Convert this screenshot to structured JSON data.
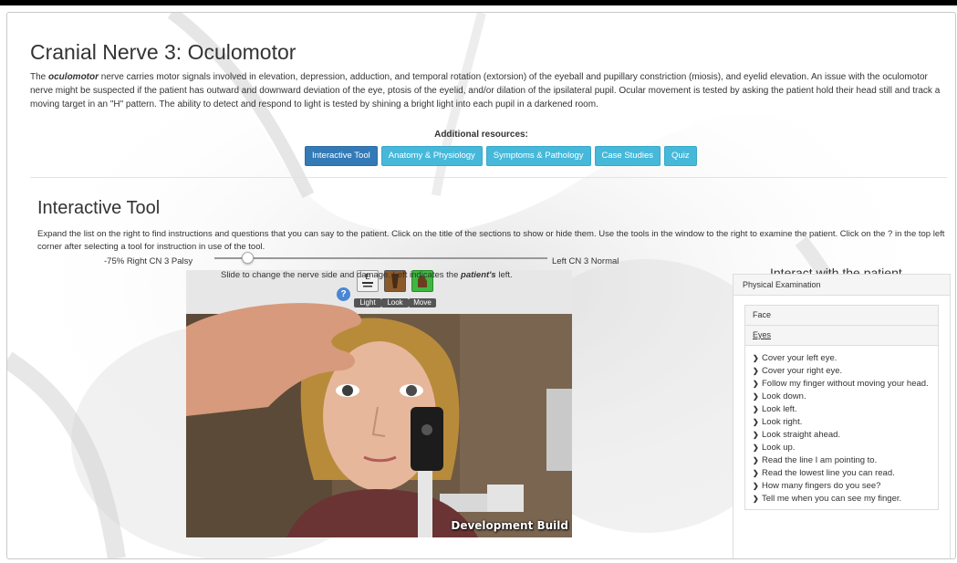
{
  "page": {
    "title": "Cranial Nerve 3: Oculomotor",
    "description_term": "oculomotor",
    "description_lead": "The",
    "description_rest": "nerve carries motor signals involved in elevation, depression, adduction, and temporal rotation (extorsion) of the eyeball and pupillary constriction (miosis), and eyelid elevation. An issue with the oculomotor nerve might be suspected if the patient has outward and downward deviation of the eye, ptosis of the eyelid, and/or dilation of the ipsilateral pupil. Ocular movement is tested by asking the patient hold their head still and track a moving target in an \"H\" pattern. The ability to detect and respond to light is tested by shining a bright light into each pupil in a darkened room.",
    "additional_resources_label": "Additional resources:"
  },
  "resources": [
    {
      "label": "Interactive Tool",
      "active": true
    },
    {
      "label": "Anatomy & Physiology",
      "active": false
    },
    {
      "label": "Symptoms & Pathology",
      "active": false
    },
    {
      "label": "Case Studies",
      "active": false
    },
    {
      "label": "Quiz",
      "active": false
    }
  ],
  "interactive": {
    "title": "Interactive Tool",
    "description": "Expand the list on the right to find instructions and questions that you can say to the patient. Click on the title of the sections to show or hide them. Use the tools in the window to the right to examine the patient. Click on the ? in the top left corner after selecting a tool for instruction in use of the tool.",
    "slider_left_label": "-75% Right CN 3 Palsy",
    "slider_right_label": "Left CN 3 Normal",
    "slider_value_fraction": 0.1,
    "slider_hint_lead": "Slide to change the nerve side and damage. Left indicates the",
    "slider_hint_term": "patient's",
    "slider_hint_tail": "left."
  },
  "game": {
    "help_label": "?",
    "tools": [
      {
        "label": "Light",
        "icon": "eye-chart-icon"
      },
      {
        "label": "Look",
        "icon": "flashlight-icon"
      },
      {
        "label": "Move",
        "icon": "hand-move-icon"
      }
    ],
    "watermark": "Development Build"
  },
  "patient_panel": {
    "heading": "Interact with the patient",
    "section_title": "Physical Examination",
    "subsections": [
      {
        "title": "Face"
      },
      {
        "title": "Eyes"
      }
    ],
    "eyes_items": [
      "Cover your left eye.",
      "Cover your right eye.",
      "Follow my finger without moving your head.",
      "Look down.",
      "Look left.",
      "Look right.",
      "Look straight ahead.",
      "Look up.",
      "Read the line I am pointing to.",
      "Read the lowest line you can read.",
      "How many fingers do you see?",
      "Tell me when you can see my finger."
    ]
  },
  "colors": {
    "primary_button": "#337ab7",
    "info_button": "#46b8da",
    "move_tool_active": "#3fb63f"
  }
}
